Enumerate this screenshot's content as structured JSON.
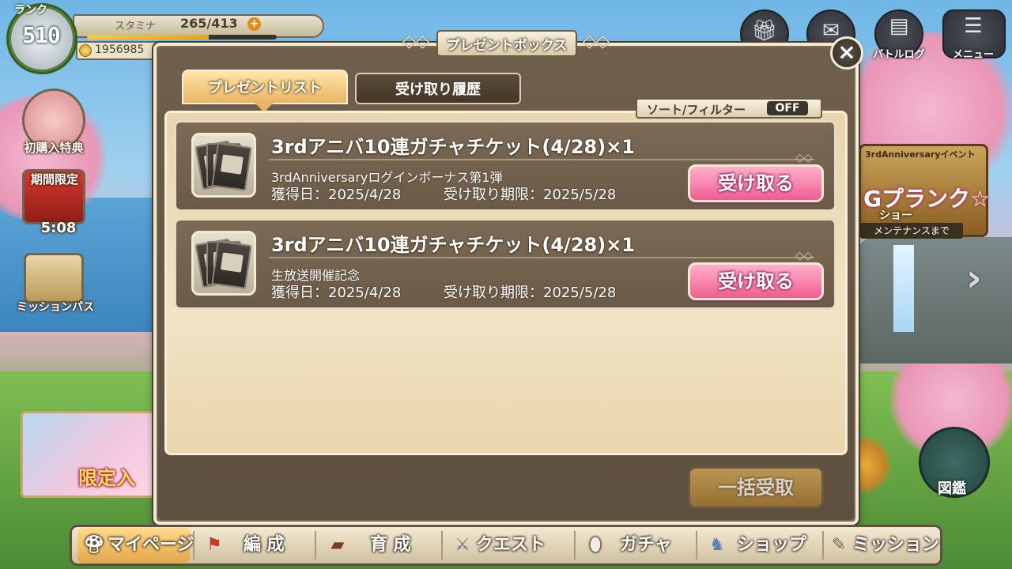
{
  "hud": {
    "rank_label": "ランク",
    "rank_value": "510",
    "stamina_label": "スタミナ",
    "stamina_value": "265/413",
    "stamina_plus": "+",
    "stamina_ratio": 0.642,
    "gold_value": "1956985",
    "top_buttons": {
      "present": {
        "icon": "gift-icon"
      },
      "mail": {
        "icon": "mail-icon"
      },
      "battle_log": {
        "label": "バトルログ",
        "icon": "document-icon"
      },
      "menu": {
        "label": "メニュー",
        "icon": "hamburger-icon"
      }
    }
  },
  "left_side": {
    "first_purchase_label": "初購入特典",
    "limited_time_label": "期間限定",
    "limited_timer": "5:08",
    "mission_pass_label": "ミッションパス",
    "banner_text": "限定入"
  },
  "right_side": {
    "event_title": "3rdAnniversaryイベント",
    "event_main": "Gプランク☆",
    "event_sub": "ショー",
    "event_countdown": "メンテナンスまで",
    "encyclopedia_label": "図鑑"
  },
  "dialog": {
    "title": "プレゼントボックス",
    "close_label": "×",
    "tabs": [
      {
        "label": "プレゼントリスト",
        "active": true
      },
      {
        "label": "受け取り履歴",
        "active": false
      }
    ],
    "sort_filter_label": "ソート/フィルター",
    "sort_filter_state": "OFF",
    "items": [
      {
        "title": "3rdアニバ10連ガチャチケット(4/28)×1",
        "description": "3rdAnniversaryログインボーナス第1弾",
        "acquired": "獲得日：2025/4/28",
        "deadline": "受け取り期限：2025/5/28",
        "claim_label": "受け取る",
        "icon": "ticket-icon"
      },
      {
        "title": "3rdアニバ10連ガチャチケット(4/28)×1",
        "description": "生放送開催記念",
        "acquired": "獲得日：2025/4/28",
        "deadline": "受け取り期限：2025/5/28",
        "claim_label": "受け取る",
        "icon": "ticket-icon"
      }
    ],
    "bulk_claim_label": "一括受取"
  },
  "bottom_nav": [
    {
      "label": "マイページ",
      "icon": "mushroom-icon",
      "active": true
    },
    {
      "label": "編 成",
      "icon": "flag-icon",
      "active": false
    },
    {
      "label": "育 成",
      "icon": "book-icon",
      "active": false
    },
    {
      "label": "クエスト",
      "icon": "crossed-swords-icon",
      "active": false
    },
    {
      "label": "ガチャ",
      "icon": "egg-icon",
      "active": false
    },
    {
      "label": "ショップ",
      "icon": "pouch-icon",
      "active": false
    },
    {
      "label": "ミッション",
      "icon": "scroll-icon",
      "active": false
    }
  ],
  "colors": {
    "claim_button": "#ef5d90",
    "active_tab": "#e9b466",
    "dialog_frame": "#f3ead2",
    "dialog_bg": "#6f5f4c"
  }
}
